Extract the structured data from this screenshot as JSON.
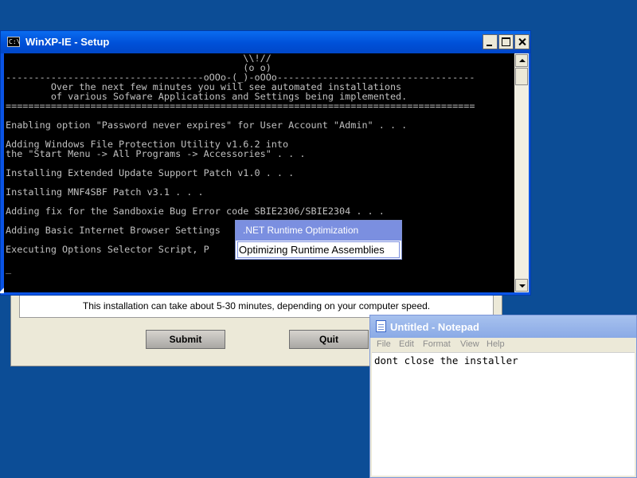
{
  "setup_dialog": {
    "info_text": "This installation can take about 5-30 minutes, depending on your computer speed.",
    "submit_label": "Submit",
    "quit_label": "Quit"
  },
  "console": {
    "title": "WinXP-IE - Setup",
    "icon": "C:\\",
    "lines": [
      "                                          \\\\!//",
      "                                          (o o)",
      "-----------------------------------oOOo-(_)-oOOo-----------------------------------",
      "        Over the next few minutes you will see automated installations",
      "        of various Sofware Applications and Settings being implemented.",
      "===================================================================================",
      "",
      "Enabling option \"Password never expires\" for User Account \"Admin\" . . .",
      "",
      "Adding Windows File Protection Utility v1.6.2 into",
      "the \"Start Menu -> All Programs -> Accessories\" . . .",
      "",
      "Installing Extended Update Support Patch v1.0 . . .",
      "",
      "Installing MNF4SBF Patch v3.1 . . .",
      "",
      "Adding fix for the Sandboxie Bug Error code SBIE2306/SBIE2304 . . .",
      "",
      "Adding Basic Internet Browser Settings",
      "",
      "Executing Options Selector Script, P",
      "",
      "_"
    ]
  },
  "popup": {
    "header": ".NET Runtime Optimization",
    "item": "Optimizing Runtime Assemblies"
  },
  "notepad": {
    "title": "Untitled - Notepad",
    "menu": [
      "File",
      "Edit",
      "Format",
      "View",
      "Help"
    ],
    "content": "dont close the installer"
  }
}
